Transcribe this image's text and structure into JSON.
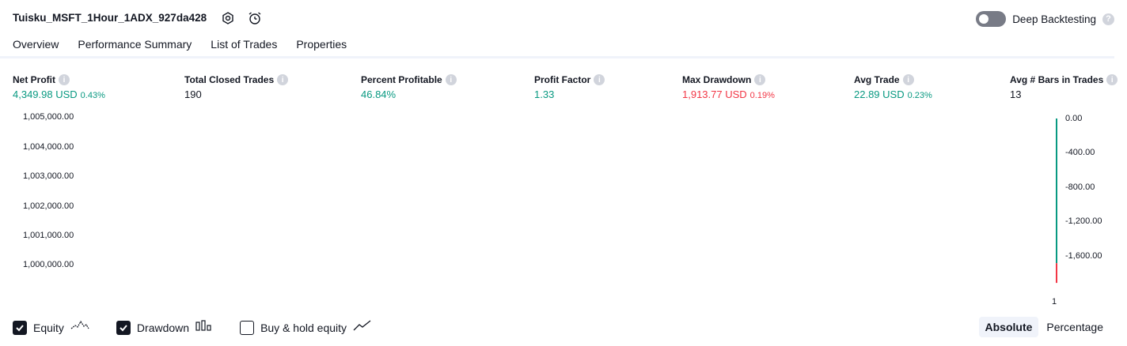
{
  "header": {
    "strategy_name": "Tuisku_MSFT_1Hour_1ADX_927da428",
    "settings_icon": "settings-icon",
    "alert_icon": "alarm-clock-icon",
    "deep_backtesting_label": "Deep Backtesting",
    "deep_backtesting_enabled": false,
    "help_glyph": "?"
  },
  "tabs": [
    {
      "label": "Overview",
      "active": true
    },
    {
      "label": "Performance Summary",
      "active": false
    },
    {
      "label": "List of Trades",
      "active": false
    },
    {
      "label": "Properties",
      "active": false
    }
  ],
  "metrics": {
    "net_profit": {
      "label": "Net Profit",
      "value": "4,349.98 USD",
      "pct": "0.43%"
    },
    "total_closed_trades": {
      "label": "Total Closed Trades",
      "value": "190"
    },
    "percent_profitable": {
      "label": "Percent Profitable",
      "value": "46.84%"
    },
    "profit_factor": {
      "label": "Profit Factor",
      "value": "1.33"
    },
    "max_drawdown": {
      "label": "Max Drawdown",
      "value": "1,913.77 USD",
      "pct": "0.19%"
    },
    "avg_trade": {
      "label": "Avg Trade",
      "value": "22.89 USD",
      "pct": "0.23%"
    },
    "avg_bars": {
      "label": "Avg # Bars in Trades",
      "value": "13"
    },
    "info_glyph": "i"
  },
  "chart_data": {
    "type": "bar",
    "left_axis_ticks": [
      "1,005,000.00",
      "1,004,000.00",
      "1,003,000.00",
      "1,002,000.00",
      "1,001,000.00",
      "1,000,000.00"
    ],
    "right_axis_ticks": [
      "0.00",
      "-400.00",
      "-800.00",
      "-1,200.00",
      "-1,600.00"
    ],
    "x_ticks": [
      "1"
    ],
    "ylim_right": [
      -1913.77,
      0
    ],
    "series": [
      {
        "name": "Drawdown",
        "values": [
          -1913.77
        ]
      }
    ],
    "colors": {
      "equity": "#089981",
      "drawdown": "#f23645"
    }
  },
  "legend": {
    "items": [
      {
        "label": "Equity",
        "checked": true,
        "icon": "equity-line-icon"
      },
      {
        "label": "Drawdown",
        "checked": true,
        "icon": "drawdown-bars-icon"
      },
      {
        "label": "Buy & hold equity",
        "checked": false,
        "icon": "buy-hold-line-icon"
      }
    ]
  },
  "view_toggle": {
    "absolute_label": "Absolute",
    "percentage_label": "Percentage",
    "selected": "Absolute"
  }
}
